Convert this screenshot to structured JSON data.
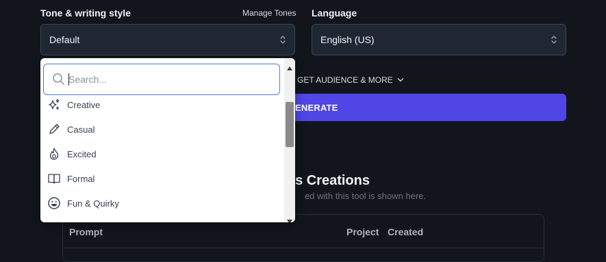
{
  "tone": {
    "label": "Tone & writing style",
    "manage_link": "Manage Tones",
    "selected": "Default"
  },
  "language": {
    "label": "Language",
    "selected": "English (US)"
  },
  "target_link": "GET AUDIENCE & MORE",
  "generate_label": "ENERATE",
  "creations": {
    "title": "s Creations",
    "subtitle": "ed with this tool is shown here."
  },
  "table": {
    "columns": [
      "Prompt",
      "Project",
      "Created"
    ]
  },
  "dropdown": {
    "search_placeholder": "Search...",
    "options": [
      {
        "label": "Creative",
        "icon": "sparkles-icon"
      },
      {
        "label": "Casual",
        "icon": "pencil-icon"
      },
      {
        "label": "Excited",
        "icon": "fire-icon"
      },
      {
        "label": "Formal",
        "icon": "book-icon"
      },
      {
        "label": "Fun & Quirky",
        "icon": "smiley-icon"
      }
    ]
  },
  "colors": {
    "background": "#13151d",
    "accent": "#4f46e5",
    "select_bg": "#1f2733",
    "focus_ring": "#4a7bd6"
  }
}
